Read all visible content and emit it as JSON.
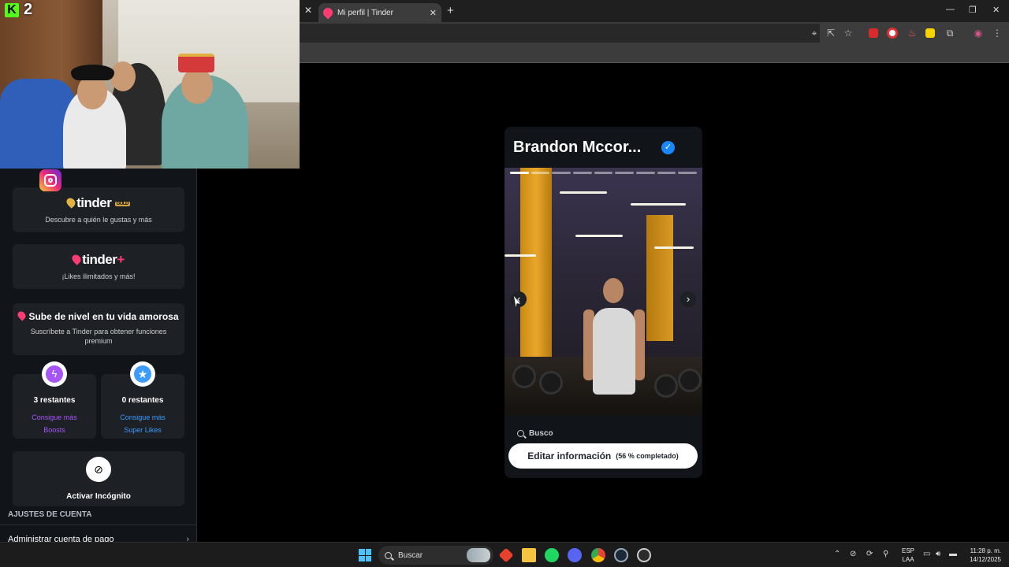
{
  "stream": {
    "viewer_count": "2"
  },
  "browser": {
    "tab_title": "Mi perfil | Tinder",
    "new_tab_label": "+",
    "close_label": "✕"
  },
  "sidebar": {
    "gold": {
      "brand": "tinder",
      "badge": "GOLD",
      "subtitle": "Descubre a quién le gustas y más"
    },
    "plus": {
      "brand": "tinder",
      "badge": "+",
      "subtitle": "¡Likes ilimitados y más!"
    },
    "upgrade": {
      "title": "Sube de nivel en tu vida amorosa",
      "subtitle": "Suscríbete a Tinder para obtener funciones premium"
    },
    "boosts": {
      "remaining": "3 restantes",
      "link_line1": "Consigue más",
      "link_line2": "Boosts",
      "accent": "#a855f7"
    },
    "superlikes": {
      "remaining": "0 restantes",
      "link_line1": "Consigue más",
      "link_line2": "Super Likes",
      "accent": "#3b9bff"
    },
    "incognito": {
      "label": "Activar Incógnito"
    },
    "account_section_title": "AJUSTES DE CUENTA",
    "account_item": "Administrar cuenta de pago"
  },
  "profile": {
    "name": "Brandon Mccor...",
    "photo_count": 9,
    "active_photo": 1,
    "search_label": "Busco",
    "edit_button": "Editar información",
    "completion": "(56 % completado)",
    "verified_color": "#1786ff"
  },
  "taskbar": {
    "search_placeholder": "Buscar",
    "lang_line1": "ESP",
    "lang_line2": "LAA",
    "time": "11:28 p. m.",
    "date": "14/12/2025"
  }
}
